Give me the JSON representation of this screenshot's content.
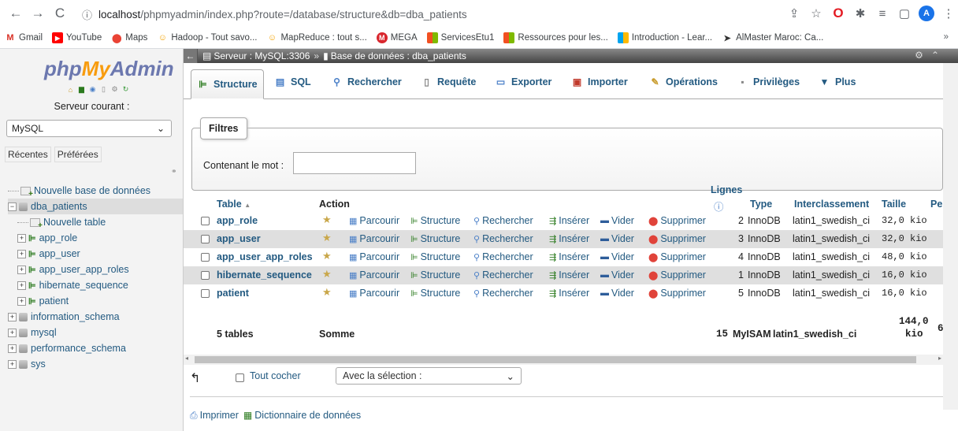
{
  "browser": {
    "url_host": "localhost",
    "url_path": "/phpmyadmin/index.php?route=/database/structure&db=dba_patients",
    "profile_initial": "A",
    "bookmarks": [
      "Gmail",
      "YouTube",
      "Maps",
      "Hadoop - Tout savo...",
      "MapReduce : tout s...",
      "MEGA",
      "ServicesEtu1",
      "Ressources pour les...",
      "Introduction - Lear...",
      "AlMaster Maroc: Ca..."
    ],
    "bookmarks_more": "»"
  },
  "sidebar": {
    "logo": {
      "php": "php",
      "my": "My",
      "admin": "Admin"
    },
    "server_label": "Serveur courant :",
    "server_value": "MySQL",
    "tabs": [
      "Récentes",
      "Préférées"
    ],
    "tree": [
      {
        "label": "Nouvelle base de données",
        "kind": "new",
        "level": 0
      },
      {
        "label": "dba_patients",
        "kind": "db",
        "level": 0,
        "selected": true
      },
      {
        "label": "Nouvelle table",
        "kind": "new",
        "level": 1
      },
      {
        "label": "app_role",
        "kind": "table",
        "level": 1
      },
      {
        "label": "app_user",
        "kind": "table",
        "level": 1
      },
      {
        "label": "app_user_app_roles",
        "kind": "table",
        "level": 1
      },
      {
        "label": "hibernate_sequence",
        "kind": "table",
        "level": 1
      },
      {
        "label": "patient",
        "kind": "table",
        "level": 1
      },
      {
        "label": "information_schema",
        "kind": "db",
        "level": 0
      },
      {
        "label": "mysql",
        "kind": "db",
        "level": 0
      },
      {
        "label": "performance_schema",
        "kind": "db",
        "level": 0
      },
      {
        "label": "sys",
        "kind": "db",
        "level": 0
      }
    ]
  },
  "main": {
    "breadcrumb": {
      "server": "Serveur : MySQL:3306",
      "sep": "»",
      "database": "Base de données : dba_patients"
    },
    "tabs": [
      "Structure",
      "SQL",
      "Rechercher",
      "Requête",
      "Exporter",
      "Importer",
      "Opérations",
      "Privilèges",
      "Plus"
    ],
    "filters": {
      "legend": "Filtres",
      "label": "Contenant le mot :",
      "value": ""
    },
    "table": {
      "headers": {
        "table": "Table",
        "sort_arrow": "▲",
        "action": "Action",
        "rows": "Lignes",
        "type": "Type",
        "collation": "Interclassement",
        "size": "Taille",
        "overhead": "Pe"
      },
      "actions": [
        "Parcourir",
        "Structure",
        "Rechercher",
        "Insérer",
        "Vider",
        "Supprimer"
      ],
      "rows": [
        {
          "name": "app_role",
          "rows": "2",
          "type": "InnoDB",
          "collation": "latin1_swedish_ci",
          "size": "32,0 kio"
        },
        {
          "name": "app_user",
          "rows": "3",
          "type": "InnoDB",
          "collation": "latin1_swedish_ci",
          "size": "32,0 kio"
        },
        {
          "name": "app_user_app_roles",
          "rows": "4",
          "type": "InnoDB",
          "collation": "latin1_swedish_ci",
          "size": "48,0 kio"
        },
        {
          "name": "hibernate_sequence",
          "rows": "1",
          "type": "InnoDB",
          "collation": "latin1_swedish_ci",
          "size": "16,0 kio"
        },
        {
          "name": "patient",
          "rows": "5",
          "type": "InnoDB",
          "collation": "latin1_swedish_ci",
          "size": "16,0 kio"
        }
      ],
      "summary": {
        "tables": "5 tables",
        "label": "Somme",
        "rows": "15",
        "type": "MyISAM",
        "collation": "latin1_swedish_ci",
        "size_1": "144,0",
        "size_2": "kio",
        "overhead": "6"
      }
    },
    "bulk": {
      "check_all": "Tout cocher",
      "with_selection": "Avec la sélection :"
    },
    "footer_links": [
      "Imprimer",
      "Dictionnaire de données"
    ]
  }
}
